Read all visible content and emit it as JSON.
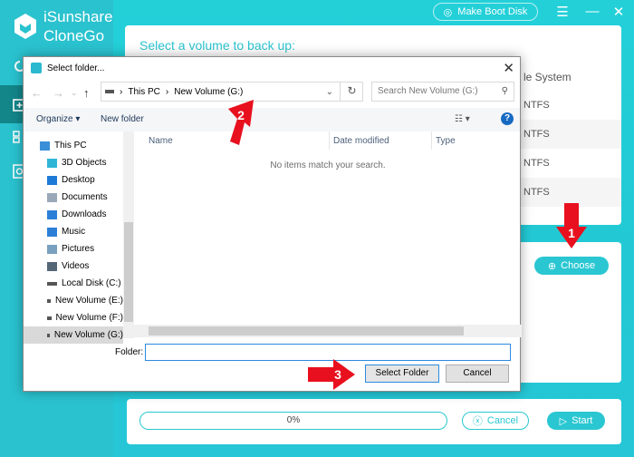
{
  "app": {
    "brand_line1": "iSunshare",
    "brand_line2": "CloneGo",
    "make_boot_disk": "Make Boot Disk",
    "main_title": "Select a volume to back up:",
    "fs_header": "le System",
    "fs_rows": [
      "NTFS",
      "NTFS",
      "NTFS",
      "NTFS"
    ],
    "choose_label": "Choose",
    "progress_label": "0%",
    "progress_value": 0,
    "cancel_label": "Cancel",
    "start_label": "Start",
    "accent": "#2ac7d2"
  },
  "dialog": {
    "title": "Select folder...",
    "breadcrumb": [
      "This PC",
      "New Volume (G:)"
    ],
    "search_placeholder": "Search New Volume (G:)",
    "organize": "Organize",
    "new_folder": "New folder",
    "tree": [
      {
        "label": "This PC",
        "icon": "computer-icon"
      },
      {
        "label": "3D Objects",
        "icon": "cube-icon"
      },
      {
        "label": "Desktop",
        "icon": "desktop-icon"
      },
      {
        "label": "Documents",
        "icon": "document-icon"
      },
      {
        "label": "Downloads",
        "icon": "download-icon"
      },
      {
        "label": "Music",
        "icon": "music-icon"
      },
      {
        "label": "Pictures",
        "icon": "pictures-icon"
      },
      {
        "label": "Videos",
        "icon": "videos-icon"
      },
      {
        "label": "Local Disk (C:)",
        "icon": "drive-icon"
      },
      {
        "label": "New Volume (E:)",
        "icon": "drive-icon"
      },
      {
        "label": "New Volume (F:)",
        "icon": "drive-icon"
      },
      {
        "label": "New Volume (G:)",
        "icon": "drive-icon"
      }
    ],
    "columns": [
      "Name",
      "Date modified",
      "Type"
    ],
    "empty_message": "No items match your search.",
    "folder_label": "Folder:",
    "folder_value": "",
    "select_folder": "Select Folder",
    "cancel": "Cancel"
  },
  "annotations": {
    "step1": "1",
    "step2": "2",
    "step3": "3",
    "color": "#e8101e"
  }
}
